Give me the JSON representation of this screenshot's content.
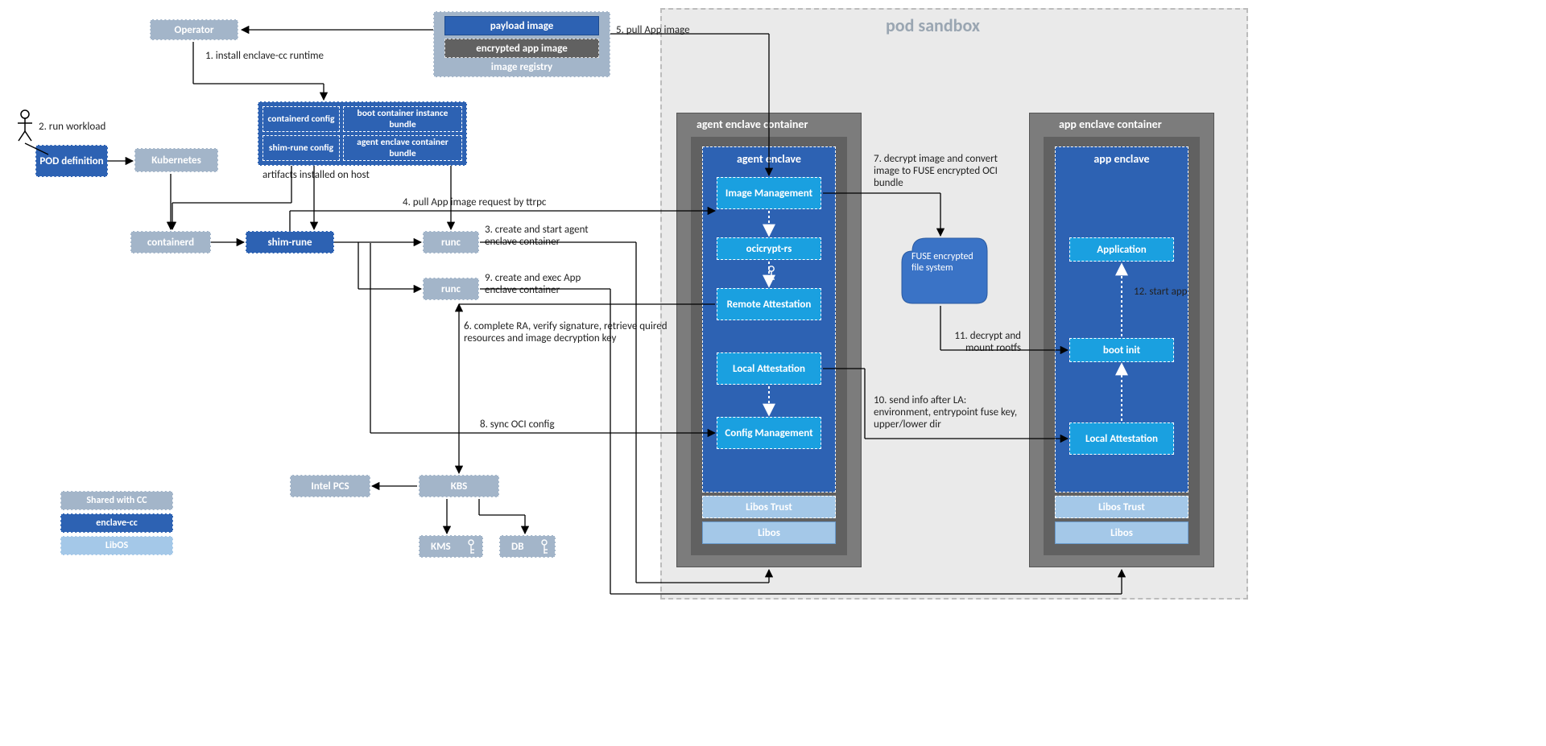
{
  "nodes": {
    "operator": "Operator",
    "payload_image": "payload image",
    "encrypted_app_image": "encrypted app image",
    "image_registry": "image registry",
    "pod_definition": "POD definition",
    "kubernetes": "Kubernetes",
    "containerd": "containerd",
    "shim_rune": "shim-rune",
    "runc1": "runc",
    "runc2": "runc",
    "intel_pcs": "Intel PCS",
    "kbs": "KBS",
    "kms": "KMS",
    "db": "DB",
    "containerd_config": "containerd config",
    "boot_container_bundle": "boot container instance bundle",
    "shim_rune_config": "shim-rune config",
    "agent_enclave_bundle": "agent enclave container bundle",
    "artifacts_installed": "artifacts installed on host",
    "pod_sandbox": "pod sandbox",
    "agent_enclave_container": "agent enclave container",
    "app_enclave_container": "app enclave container",
    "agent_enclave": "agent enclave",
    "app_enclave": "app enclave",
    "image_mgmt": "Image Management",
    "ocicrypt_rs": "ocicrypt-rs",
    "remote_attestation": "Remote Attestation",
    "local_attestation": "Local Attestation",
    "config_mgmt": "Config Management",
    "libos_trust_a": "Libos Trust",
    "libos_a": "Libos",
    "application": "Application",
    "boot_init": "boot init",
    "local_attestation_b": "Local Attestation",
    "libos_trust_b": "Libos Trust",
    "libos_b": "Libos",
    "fuse_fs": "FUSE encrypted file system"
  },
  "edges": {
    "e1": "1. install enclave-cc runtime",
    "e2": "2. run workload",
    "e3": "3. create and start agent enclave container",
    "e4": "4. pull App image request by ttrpc",
    "e5": "5. pull App image",
    "e6": "6. complete RA, verify signature, retrieve quired resources and image decryption key",
    "e7": "7. decrypt  image and convert image to FUSE encrypted OCI bundle",
    "e8": "8. sync OCI config",
    "e9": "9. create and exec App enclave container",
    "e10": "10. send info after LA: environment, entrypoint fuse key, upper/lower dir",
    "e11": "11. decrypt and mount rootfs",
    "e12": "12. start app"
  },
  "legend": {
    "shared": "Shared with  CC",
    "enclave_cc": "enclave-cc",
    "libos": "LibOS"
  }
}
